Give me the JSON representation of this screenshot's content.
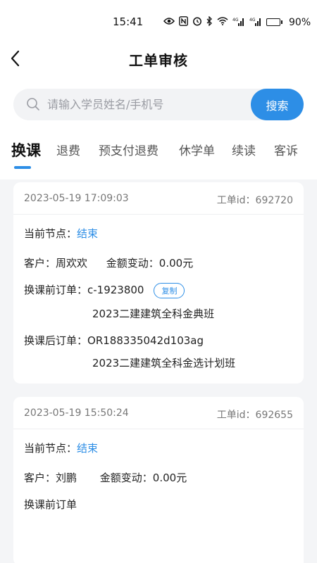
{
  "status_bar": {
    "time": "15:41",
    "battery": "90%",
    "battery_level": 0.9
  },
  "header": {
    "title": "工单审核"
  },
  "search": {
    "placeholder": "请输入学员姓名/手机号",
    "button_label": "搜索"
  },
  "tabs": [
    "换课",
    "退费",
    "预支付退费",
    "休学单",
    "续读",
    "客诉"
  ],
  "active_tab": "换课",
  "cards": [
    {
      "date": "2023-05-19 17:09:03",
      "id_text": "工单id：692720",
      "node_label": "当前节点：",
      "node_value": "结束",
      "customer_label": "客户：周欢欢",
      "amount_label": "金额变动：0.00元",
      "before_label": "换课前订单：",
      "before_order": "c-1923800",
      "copy_label": "复制",
      "before_course": "2023二建建筑全科金典班",
      "after_label": "换课后订单：",
      "after_order": "OR188335042d103ag",
      "after_course": "2023二建建筑全科金选计划班"
    },
    {
      "date": "2023-05-19 15:50:24",
      "id_text": "工单id：692655",
      "node_label": "当前节点：",
      "node_value": "结束",
      "customer_label": "客户：刘鹏",
      "amount_label": "金额变动：0.00元",
      "before_label": "换课前订单"
    }
  ]
}
